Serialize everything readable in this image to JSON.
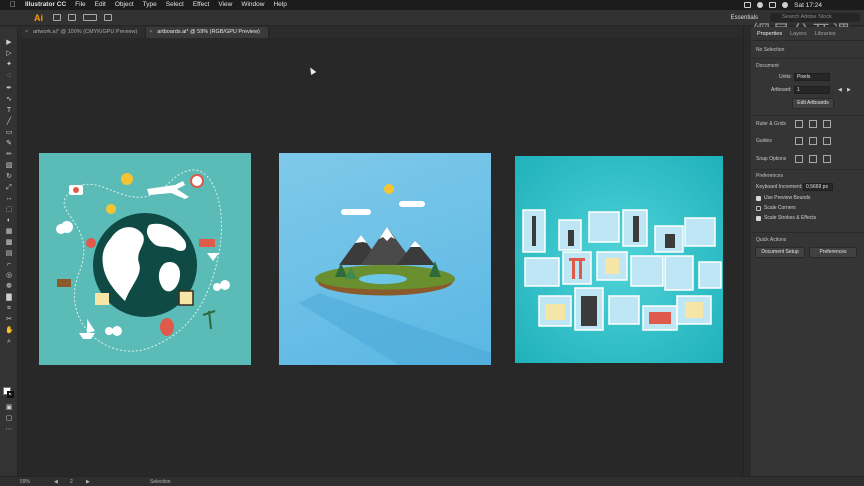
{
  "menubar": {
    "app_name": "Illustrator CC",
    "items": [
      "File",
      "Edit",
      "Object",
      "Type",
      "Select",
      "Effect",
      "View",
      "Window",
      "Help"
    ],
    "clock": "Sat 17:24"
  },
  "appbar": {
    "logo": "Ai",
    "workspace": "Essentials",
    "search_placeholder": "Search Adobe Stock",
    "watermark": "網易公开课"
  },
  "tabs": [
    {
      "label": "artwork.ai* @ 100% (CMYK/GPU Preview)",
      "active": false
    },
    {
      "label": "artboards.ai* @ 59% (RGB/GPU Preview)",
      "active": true
    }
  ],
  "panel": {
    "tabs": [
      "Properties",
      "Layers",
      "Libraries"
    ],
    "no_selection": "No Selection",
    "document_label": "Document",
    "units_label": "Units:",
    "units_value": "Pixels",
    "artboard_label": "Artboard:",
    "artboard_value": "1",
    "edit_artboards": "Edit Artboards",
    "rulers_grids": "Ruler & Grids",
    "guides": "Guides",
    "snap_options": "Snap Options",
    "preferences_label": "Preferences",
    "keyboard_increment_label": "Keyboard Increment:",
    "keyboard_increment_value": "0.5669 px",
    "use_preview_bounds": "Use Preview Bounds",
    "scale_corners": "Scale Corners",
    "scale_strokes": "Scale Strokes & Effects",
    "quick_actions": "Quick Actions",
    "document_setup": "Document Setup",
    "preferences_button": "Preferences"
  },
  "statusbar": {
    "zoom": "59%",
    "artboard": "2",
    "mode": "Selection"
  },
  "colors": {
    "artboard1_bg": "#5bbcb7",
    "artboard2_bg": "#6cc0e6",
    "artboard3_bg": "#2dc2c9",
    "ai_orange": "#ff9a00"
  }
}
